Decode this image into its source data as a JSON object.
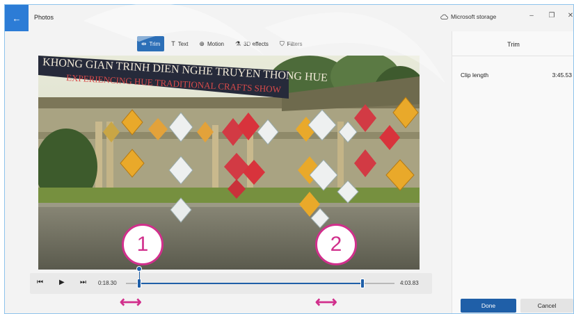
{
  "window": {
    "back_icon": "back-arrow-icon",
    "title": "Photos",
    "storage_label": "Microsoft storage",
    "minimize": "–",
    "restore": "❐",
    "close": "✕"
  },
  "toolbar": {
    "items": [
      {
        "label": "Trim",
        "icon": "trim-icon",
        "glyph": "⇹",
        "active": true
      },
      {
        "label": "Text",
        "icon": "text-icon",
        "glyph": "T",
        "active": false
      },
      {
        "label": "Motion",
        "icon": "motion-icon",
        "glyph": "⊕",
        "active": false
      },
      {
        "label": "3D effects",
        "icon": "3d-effects-icon",
        "glyph": "⚗",
        "active": false
      },
      {
        "label": "Filters",
        "icon": "filters-icon",
        "glyph": "⛉",
        "active": false
      }
    ]
  },
  "video": {
    "sign_line1": "KHONG GIAN TRINH DIEN NGHE TRUYEN THONG HUE",
    "sign_line2": "EXPERIENCING HUE TRADITIONAL CRAFTS SHOW",
    "marker1": "1",
    "marker2": "2"
  },
  "playback": {
    "prev_frame": "◀",
    "play": "▶",
    "next_frame": "▶",
    "start_time": "0:18.30",
    "end_time": "4:03.83",
    "trim_start_fraction": 0.05,
    "trim_end_fraction": 0.88,
    "playhead_fraction": 0.05
  },
  "panel": {
    "title": "Trim",
    "clip_length_label": "Clip length",
    "clip_length_value": "3:45.53",
    "done_label": "Done",
    "cancel_label": "Cancel"
  },
  "colors": {
    "accent": "#1f5fa8",
    "annotation": "#d12f8c",
    "back_button": "#2c7cd6"
  }
}
